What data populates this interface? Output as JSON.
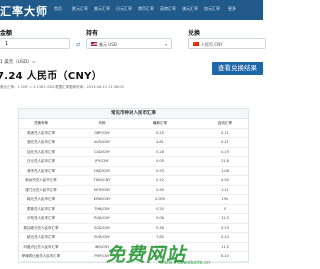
{
  "header": {
    "logo": "汇率大师",
    "nav": [
      "首页",
      "欧元汇率",
      "美元汇率",
      "日元汇率",
      "港币汇率",
      "英镑汇率",
      "澳元汇率",
      "加元汇率",
      "更多"
    ]
  },
  "form": {
    "amount_label": "金额",
    "amount_value": "1",
    "swap_label": "⇄",
    "from_label": "持有",
    "from_value": "美元 USD",
    "to_label": "兑换",
    "to_value": "人民币 CNY"
  },
  "result": {
    "small": "1 美元（USD）=",
    "big": "7.24 人民币（CNY）",
    "button": "查看兑换结果",
    "note": "美元汇率：1 CNY = 0.1381 USD   数据汇率更新时间：2024-06-13 11:38:00"
  },
  "table": {
    "title": "常见币种对人民币汇率",
    "headers": [
      "兑换币种",
      "代码",
      "最新汇率",
      "反向汇率"
    ],
    "rows": [
      [
        "英镑兑人民币汇率",
        "GBP/CNY",
        "9.25",
        "0.11"
      ],
      [
        "澳元兑人民币汇率",
        "AUD/CNY",
        "4.81",
        "0.21"
      ],
      [
        "加元兑人民币汇率",
        "CAD/CNY",
        "5.28",
        "0.19"
      ],
      [
        "日元兑人民币汇率",
        "JPY/CNY",
        "0.05",
        "21.8"
      ],
      [
        "港币兑人民币汇率",
        "HKD/CNY",
        "0.93",
        "1.08"
      ],
      [
        "新台币兑人民币汇率",
        "TWD/CNY",
        "0.22",
        "4.50"
      ],
      [
        "澳门元兑人民币汇率",
        "MOP/CNY",
        "0.90",
        "1.11"
      ],
      [
        "韩元兑人民币汇率",
        "KRW/CNY",
        "0.005",
        "190"
      ],
      [
        "泰铢兑人民币汇率",
        "THB/CNY",
        "0.20",
        "5"
      ],
      [
        "卢布兑人民币汇率",
        "RUB/CNY",
        "0.08",
        "12.5"
      ],
      [
        "新加坡元兑人民币汇率",
        "SGD/CNY",
        "5.36",
        "0.19"
      ],
      [
        "欧元兑人民币汇率",
        "EUR/CNY",
        "7.80",
        "0.13"
      ],
      [
        "印度卢比兑人民币汇率",
        "INR/CNY",
        "0.087",
        "11.5"
      ],
      [
        "菲律宾比索兑人民币汇率",
        "PHP/CNY",
        "0.12",
        "8.10"
      ]
    ]
  },
  "watermark": {
    "main": "免费网站",
    "sub": "www.freewebsite.cn"
  },
  "colors": {
    "header": "#1f5a8a",
    "button": "#1f67a8",
    "watermark": "#2d9a3a"
  }
}
